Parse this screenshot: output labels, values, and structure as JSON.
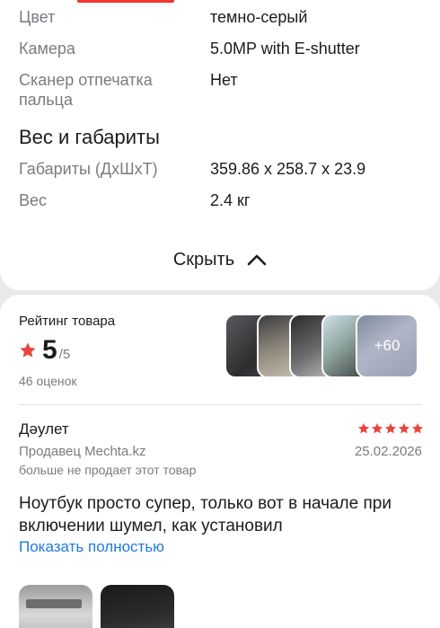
{
  "specs": {
    "rows": [
      {
        "label": "Цвет",
        "value": "темно-серый"
      },
      {
        "label": "Камера",
        "value": "5.0MP with E-shutter"
      },
      {
        "label": "Сканер отпечатка пальца",
        "value": "Нет"
      }
    ],
    "section_title": "Вес и габариты",
    "dimension_rows": [
      {
        "label": "Габариты (ДхШхТ)",
        "value": "359.86 x 258.7 x 23.9"
      },
      {
        "label": "Вес",
        "value": "2.4 кг"
      }
    ],
    "hide_label": "Скрыть"
  },
  "rating": {
    "title": "Рейтинг товара",
    "value": "5",
    "max": "/5",
    "count": "46 оценок",
    "more_photos": "+60"
  },
  "review": {
    "author": "Дәулет",
    "stars": 5,
    "seller": "Продавец Mechta.kz",
    "date": "25.02.2026",
    "note": "больше не продает этот товар",
    "text": "Ноутбук просто супер, только вот в начале при включении шумел, как установил",
    "show_more": "Показать полностью"
  },
  "colors": {
    "accent_red": "#f0362f",
    "star": "#e8453c",
    "link": "#1f7ae0",
    "muted_text": "#7b7b80",
    "page_bg": "#e9e9ec"
  },
  "icons": {
    "chevron": "chevron-up-icon",
    "star": "star-icon"
  }
}
